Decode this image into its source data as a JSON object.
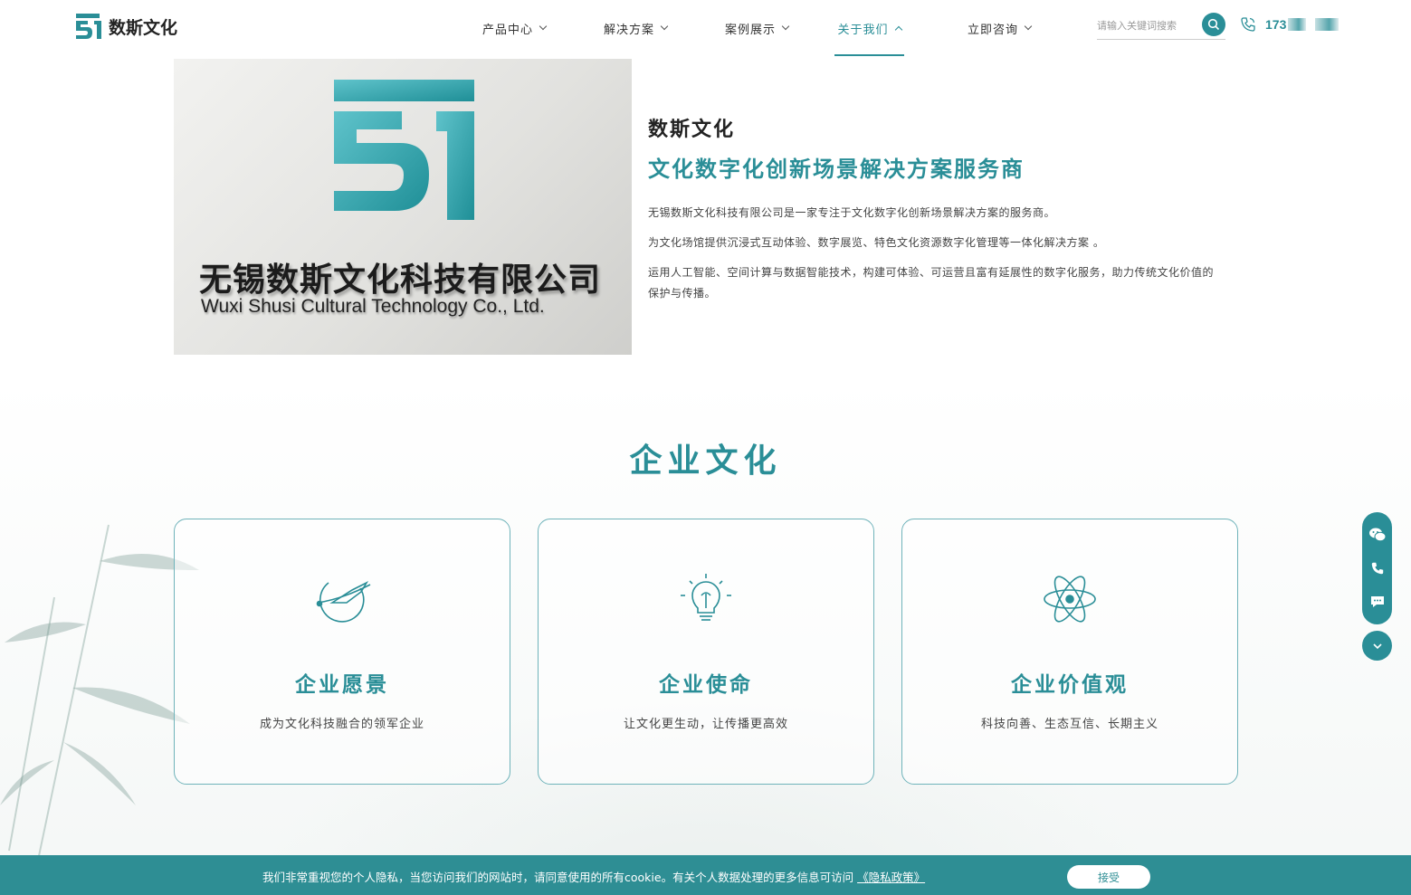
{
  "brand": {
    "name": "数斯文化",
    "accent_color": "#2a8e97"
  },
  "nav": {
    "items": [
      {
        "label": "产品中心",
        "active": false
      },
      {
        "label": "解决方案",
        "active": false
      },
      {
        "label": "案例展示",
        "active": false
      },
      {
        "label": "关于我们",
        "active": true
      },
      {
        "label": "立即咨询",
        "active": false
      }
    ]
  },
  "search": {
    "placeholder": "请输入关键词搜索",
    "icon": "search-icon"
  },
  "contact": {
    "phone_prefix": "173"
  },
  "about": {
    "image": {
      "sign_cn": "无锡数斯文化科技有限公司",
      "sign_en": "Wuxi Shusi Cultural Technology Co., Ltd."
    },
    "company": "数斯文化",
    "slogan": "文化数字化创新场景解决方案服务商",
    "paragraphs": [
      "无锡数斯文化科技有限公司是一家专注于文化数字化创新场景解决方案的服务商。",
      "为文化场馆提供沉浸式互动体验、数字展览、特色文化资源数字化管理等一体化解决方案 。",
      "运用人工智能、空间计算与数据智能技术，构建可体验、可运营且富有延展性的数字化服务，助力传统文化价值的保护与传播。"
    ]
  },
  "culture": {
    "title": "企业文化",
    "cards": [
      {
        "title": "企业愿景",
        "desc": "成为文化科技融合的领军企业",
        "icon": "rocket-globe-icon"
      },
      {
        "title": "企业使命",
        "desc": "让文化更生动，让传播更高效",
        "icon": "lightbulb-icon"
      },
      {
        "title": "企业价值观",
        "desc": "科技向善、生态互信、长期主义",
        "icon": "atom-icon"
      }
    ]
  },
  "sidebar": {
    "items": [
      "wechat-icon",
      "phone-icon",
      "message-icon"
    ],
    "scroll": "chevron-down-icon"
  },
  "cookie": {
    "text": "我们非常重视您的个人隐私，当您访问我们的网站时，请同意使用的所有cookie。有关个人数据处理的更多信息可访问",
    "link": "《隐私政策》",
    "accept": "接受"
  }
}
